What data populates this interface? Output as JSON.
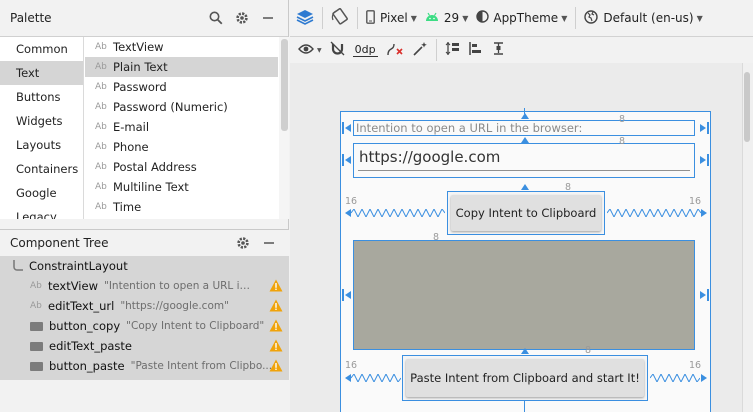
{
  "palette": {
    "title": "Palette",
    "categories": [
      "Common",
      "Text",
      "Buttons",
      "Widgets",
      "Layouts",
      "Containers",
      "Google",
      "Legacy"
    ],
    "selected_category": "Text",
    "items": [
      {
        "icon": "Ab",
        "label": "TextView"
      },
      {
        "icon": "Ab",
        "label": "Plain Text"
      },
      {
        "icon": "Ab",
        "label": "Password"
      },
      {
        "icon": "Ab",
        "label": "Password (Numeric)"
      },
      {
        "icon": "Ab",
        "label": "E-mail"
      },
      {
        "icon": "Ab",
        "label": "Phone"
      },
      {
        "icon": "Ab",
        "label": "Postal Address"
      },
      {
        "icon": "Ab",
        "label": "Multiline Text"
      },
      {
        "icon": "Ab",
        "label": "Time"
      }
    ],
    "selected_item": "Plain Text"
  },
  "component_tree": {
    "title": "Component Tree",
    "root": "ConstraintLayout",
    "children": [
      {
        "type": "text",
        "name": "textView",
        "value": "\"Intention to open a URL in t...",
        "warning": true
      },
      {
        "type": "text",
        "name": "editText_url",
        "value": "\"https://google.com\"",
        "warning": true
      },
      {
        "type": "button",
        "name": "button_copy",
        "value": "\"Copy Intent to Clipboard\"",
        "warning": true
      },
      {
        "type": "button",
        "name": "editText_paste",
        "value": "",
        "warning": true
      },
      {
        "type": "button",
        "name": "button_paste",
        "value": "\"Paste Intent from Clipbo...",
        "warning": true
      }
    ]
  },
  "toolbar": {
    "device": "Pixel",
    "api": "29",
    "theme": "AppTheme",
    "locale": "Default (en-us)",
    "margin_value": "0dp"
  },
  "canvas": {
    "textview_text": "Intention to open a URL in the browser:",
    "edittext_url": "https://google.com",
    "button_copy": "Copy Intent to Clipboard",
    "button_paste": "Paste Intent from Clipboard and start It!",
    "margin_label": "16",
    "small_margin": "8"
  },
  "colors": {
    "blueprint": "#3b8fe0",
    "warning": "#f0a30a",
    "selection": "#d5d5d5",
    "paste_field": "#a8a89e"
  }
}
